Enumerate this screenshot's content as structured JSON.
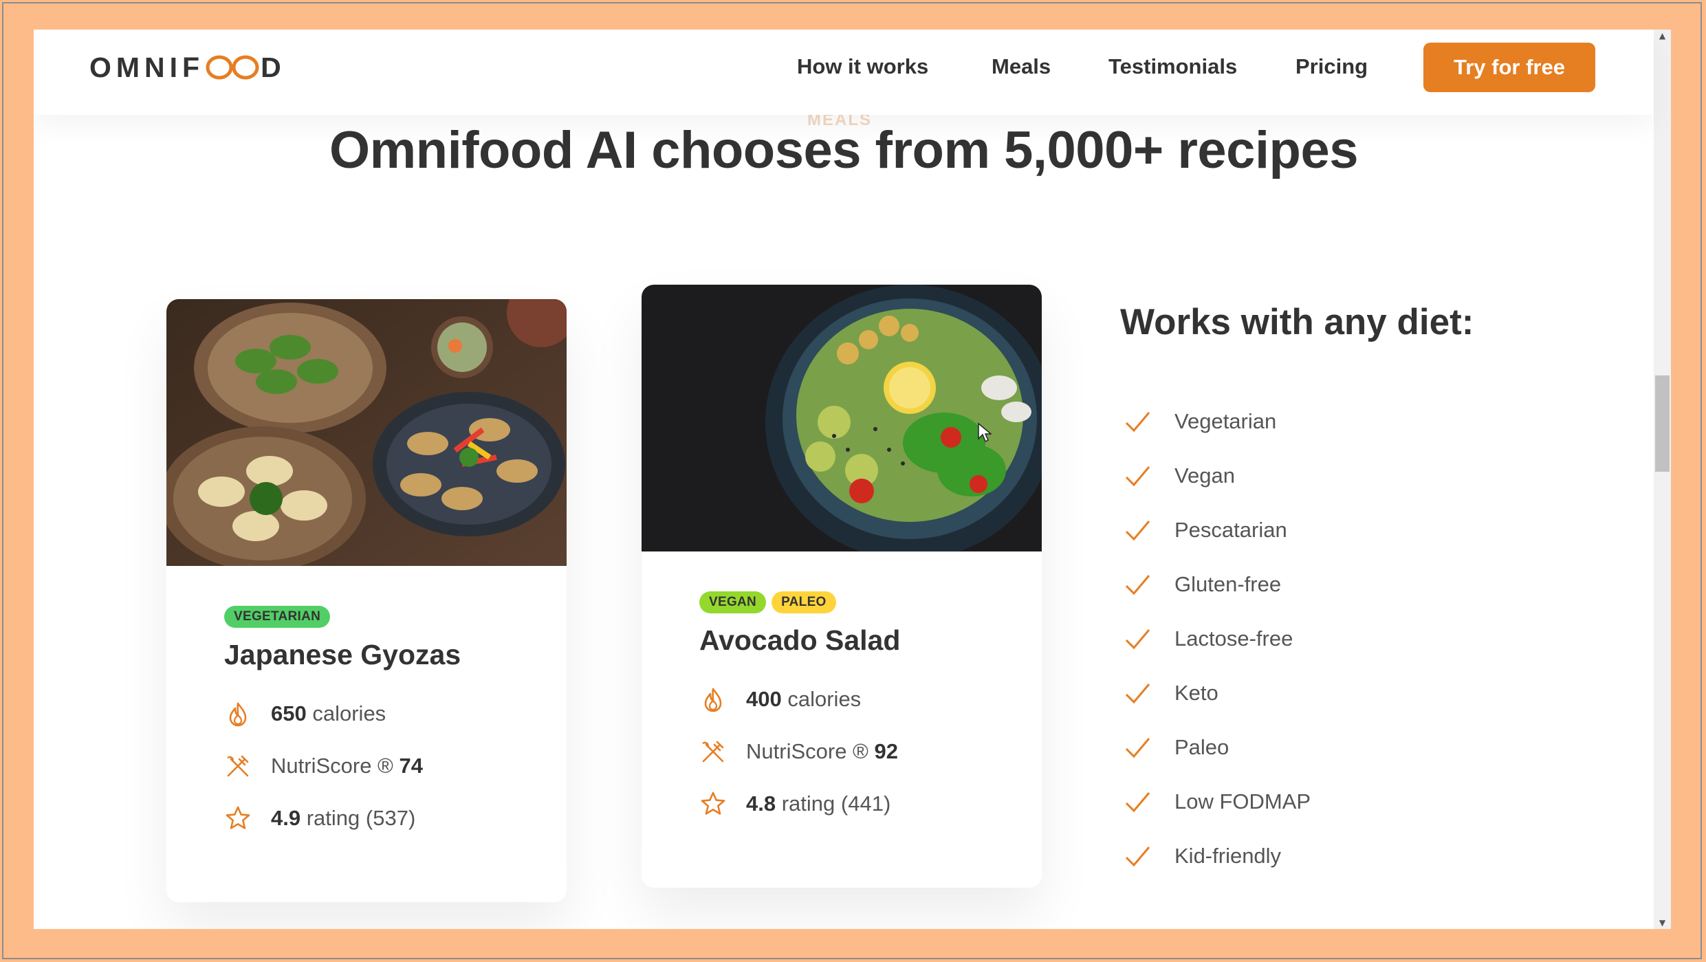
{
  "header": {
    "logo_text_left": "OMNIF",
    "logo_text_right": "D",
    "nav_links": [
      "How it works",
      "Meals",
      "Testimonials",
      "Pricing"
    ],
    "cta_label": "Try for free"
  },
  "section": {
    "subheading": "MEALS",
    "heading": "Omnifood AI chooses from 5,000+ recipes"
  },
  "meals": [
    {
      "image": "japanese-gyozas-photo",
      "tags": [
        {
          "label": "Vegetarian",
          "color": "#51cf66"
        }
      ],
      "title": "Japanese Gyozas",
      "calories_value": "650",
      "calories_label": "calories",
      "nutriscore_label": "NutriScore ®",
      "nutriscore_value": "74",
      "rating_value": "4.9",
      "rating_label": "rating (537)"
    },
    {
      "image": "avocado-salad-photo",
      "tags": [
        {
          "label": "Vegan",
          "color": "#94d82d"
        },
        {
          "label": "Paleo",
          "color": "#ffd43b"
        }
      ],
      "title": "Avocado Salad",
      "calories_value": "400",
      "calories_label": "calories",
      "nutriscore_label": "NutriScore ®",
      "nutriscore_value": "92",
      "rating_value": "4.8",
      "rating_label": "rating (441)"
    }
  ],
  "diets": {
    "title": "Works with any diet:",
    "items": [
      "Vegetarian",
      "Vegan",
      "Pescatarian",
      "Gluten-free",
      "Lactose-free",
      "Keto",
      "Paleo",
      "Low FODMAP",
      "Kid-friendly"
    ]
  },
  "colors": {
    "accent": "#e67e22",
    "frame": "#fdbb8a",
    "text": "#333333"
  },
  "icons": {
    "calories": "flame-icon",
    "nutriscore": "utensils-icon",
    "rating": "star-icon",
    "diet_item": "checkmark-icon"
  }
}
